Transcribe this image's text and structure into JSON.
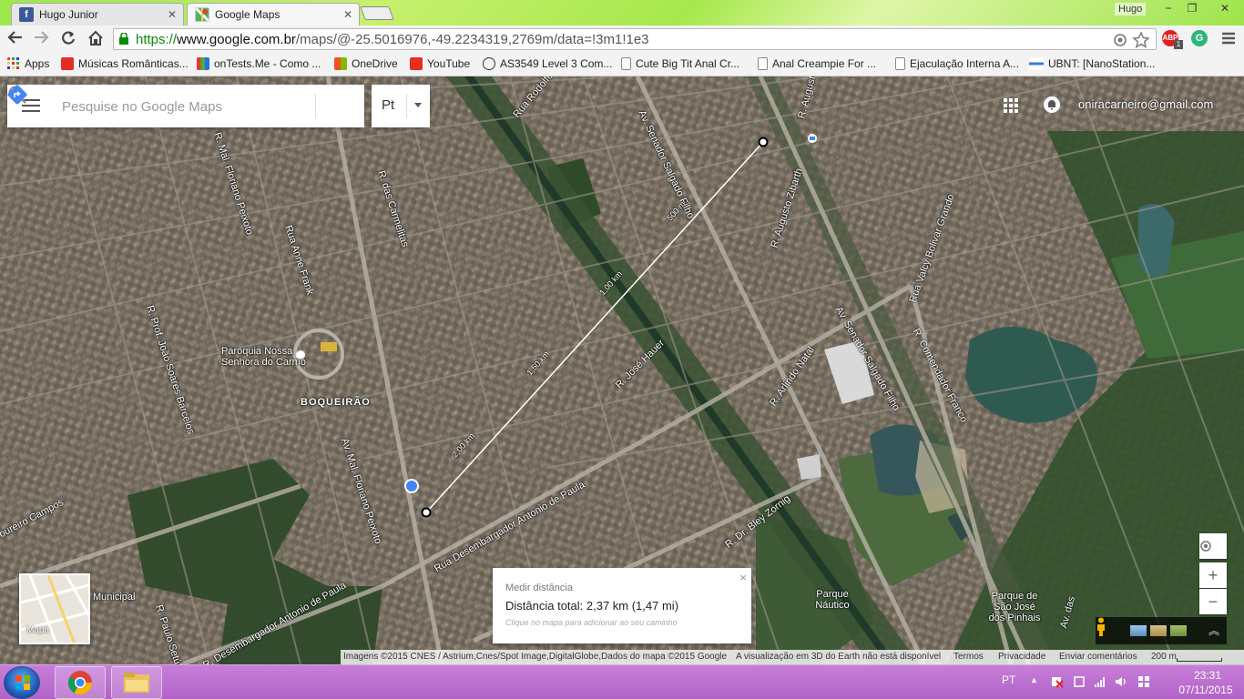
{
  "browser": {
    "tabs": [
      {
        "label": "Hugo Junior",
        "favicon": "facebook-icon"
      },
      {
        "label": "Google Maps",
        "favicon": "google-maps-icon"
      }
    ],
    "profile_name": "Hugo",
    "window_buttons": {
      "minimize": "−",
      "maximize": "❐",
      "close": "✕"
    },
    "url": {
      "protocol": "https://",
      "host": "www.google.com.br",
      "path": "/maps/@-25.5016976,-49.2234319,2769m/data=!3m1!1e3"
    },
    "extensions": [
      {
        "icon": "abp-icon",
        "label": "ABP",
        "badge": "1"
      },
      {
        "icon": "grammarly-icon",
        "label": "G"
      }
    ],
    "bookmarks": [
      {
        "label": "Apps",
        "icon": "apps-grid-icon"
      },
      {
        "label": "Músicas Românticas...",
        "icon": "youtube-icon"
      },
      {
        "label": "onTests.Me - Como ...",
        "icon": "chart-icon"
      },
      {
        "label": "OneDrive",
        "icon": "windows-icon"
      },
      {
        "label": "YouTube",
        "icon": "youtube-icon"
      },
      {
        "label": "AS3549 Level 3 Com...",
        "icon": "globe-icon"
      },
      {
        "label": "Cute Big Tit Anal Cr...",
        "icon": "page-icon"
      },
      {
        "label": "Anal Creampie For ...",
        "icon": "page-icon"
      },
      {
        "label": "Ejaculação Interna A...",
        "icon": "page-icon"
      },
      {
        "label": "UBNT: [NanoStation...",
        "icon": "ubnt-icon"
      }
    ]
  },
  "maps": {
    "search_placeholder": "Pesquise no Google Maps",
    "language": "Pt",
    "account_email": "oniracarneiro@gmail.com",
    "labels": [
      {
        "text": "Paróquia Nossa",
        "kind": "poi"
      },
      {
        "text": "Senhora do Carmo",
        "kind": "poi"
      },
      {
        "text": "BOQUEIRÃO",
        "kind": "district"
      },
      {
        "text": "Av. Mal. Floriano Peixoto",
        "kind": "street"
      },
      {
        "text": "R. Mal. Floriano Peixoto",
        "kind": "street"
      },
      {
        "text": "Rua Anne Frank",
        "kind": "street"
      },
      {
        "text": "R. das Carmelitas",
        "kind": "street"
      },
      {
        "text": "R. Prof. João Soares Barcelos",
        "kind": "street"
      },
      {
        "text": "R. José Hauer",
        "kind": "street"
      },
      {
        "text": "Av. Senador Salgado Filho",
        "kind": "street"
      },
      {
        "text": "Av. Senador Salgado Filho",
        "kind": "street"
      },
      {
        "text": "R. Augusto Zibarth",
        "kind": "street"
      },
      {
        "text": "R. Arlindo Natal",
        "kind": "street"
      },
      {
        "text": "R. Comendador Franco",
        "kind": "street"
      },
      {
        "text": "Rua Valcy Bolivar Grando",
        "kind": "street"
      },
      {
        "text": "Rua Desembargador Antonio de Paula",
        "kind": "street"
      },
      {
        "text": "R. Desembargador Antonio de Paula",
        "kind": "street"
      },
      {
        "text": "R. Dr. Bley Zornig",
        "kind": "street"
      },
      {
        "text": "Parque Náutico",
        "kind": "park"
      },
      {
        "text": "Parque de São José dos Pinhais",
        "kind": "park"
      },
      {
        "text": "R. Paulo Setúbal",
        "kind": "street"
      },
      {
        "text": "Municipal",
        "kind": "park"
      },
      {
        "text": "oureiro Campos",
        "kind": "street"
      },
      {
        "text": "Rua Rodolfo",
        "kind": "street"
      },
      {
        "text": "R. Augusto",
        "kind": "street"
      },
      {
        "text": "Av. das",
        "kind": "street"
      }
    ],
    "measure": {
      "title": "Medir distância",
      "total": "Distância total: 2,37 km (1,47 mi)",
      "hint": "Clique no mapa para adicionar ao seu caminho",
      "close": "×",
      "segment_labels": [
        "2,00 km",
        "1,50 km",
        "1,00 km",
        "500 m"
      ]
    },
    "minimap_label": "Mapa",
    "controls": {
      "zoom_in": "+",
      "zoom_out": "−",
      "locate": "my-location-icon"
    },
    "footer": {
      "attribution": "Imagens ©2015 CNES / Astrium,Cnes/Spot Image,DigitalGlobe,Dados do mapa ©2015 Google",
      "earth_notice": "A visualização em 3D do Earth não está disponível",
      "terms": "Termos",
      "privacy": "Privacidade",
      "feedback": "Enviar comentários",
      "scale": "200 m"
    }
  },
  "taskbar": {
    "language": "PT",
    "time": "23:31",
    "date": "07/11/2015",
    "pinned": [
      "chrome-icon",
      "file-explorer-icon"
    ]
  },
  "colors": {
    "accent_green": "#9be84a",
    "maps_blue": "#4285f4",
    "taskbar_purple": "#b163c8"
  }
}
